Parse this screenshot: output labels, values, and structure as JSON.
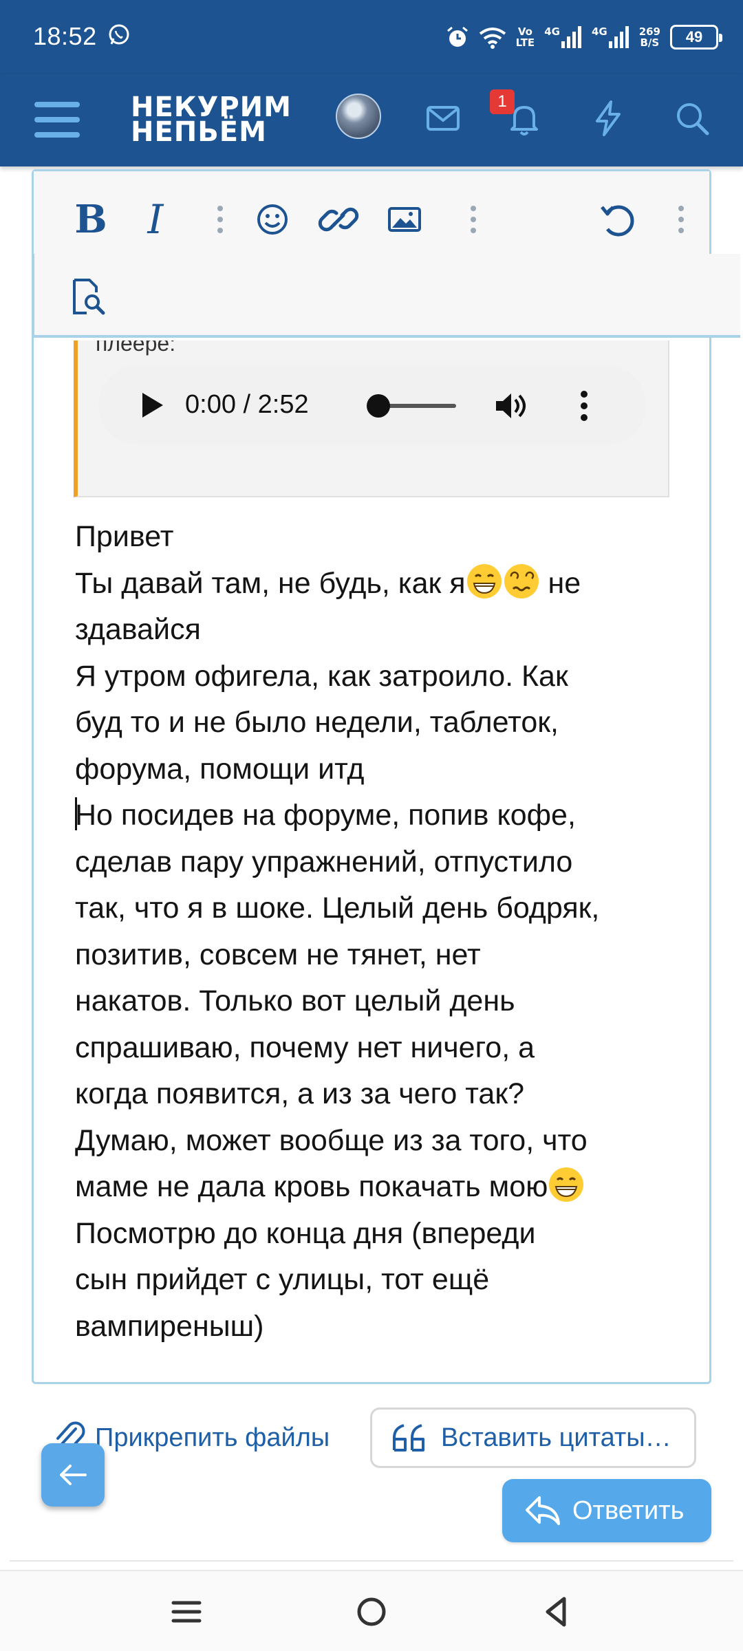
{
  "status_bar": {
    "time": "18:52",
    "network_speed_value": "269",
    "network_speed_unit": "B/S",
    "volte_top": "Vo",
    "volte_bottom": "LTE",
    "signal1_label": "4G",
    "signal2_label": "4G",
    "battery": "49"
  },
  "header": {
    "logo_line1": "НЕКУРИМ",
    "logo_line2": "НЕПЬЁМ",
    "notifications_count": "1"
  },
  "editor": {
    "quote_cut_text": "плеере:",
    "player_time": "0:00 / 2:52",
    "message_paragraphs": [
      "Привет",
      "Ты давай там, не будь, как я",
      " не",
      "здавайся",
      "Я утром офигела, как затроило. Как",
      "буд то и не было недели, таблеток,",
      "форума, помощи итд",
      "Но посидев на форуме, попив кофе,",
      "сделав пару упражнений, отпустило",
      "так, что я в шоке. Целый день бодряк,",
      "позитив, совсем не тянет, нет",
      "накатов. Только вот целый день",
      "спрашиваю, почему нет ничего, а",
      "когда появится, а из за чего так?",
      "Думаю, может вообще из за того, что",
      "маме не дала кровь покачать мою",
      "Посмотрю до конца дня (впереди",
      "сын прийдет с улицы, тот ещё",
      "вампиреныш)"
    ]
  },
  "actions": {
    "attach_label": "Прикрепить файлы",
    "insert_quotes_label": "Вставить цитаты…",
    "reply_label": "Ответить"
  },
  "colors": {
    "brand": "#1c5390",
    "accent": "#55a9ea",
    "quote_bar": "#f0a023",
    "badge": "#e53935"
  }
}
